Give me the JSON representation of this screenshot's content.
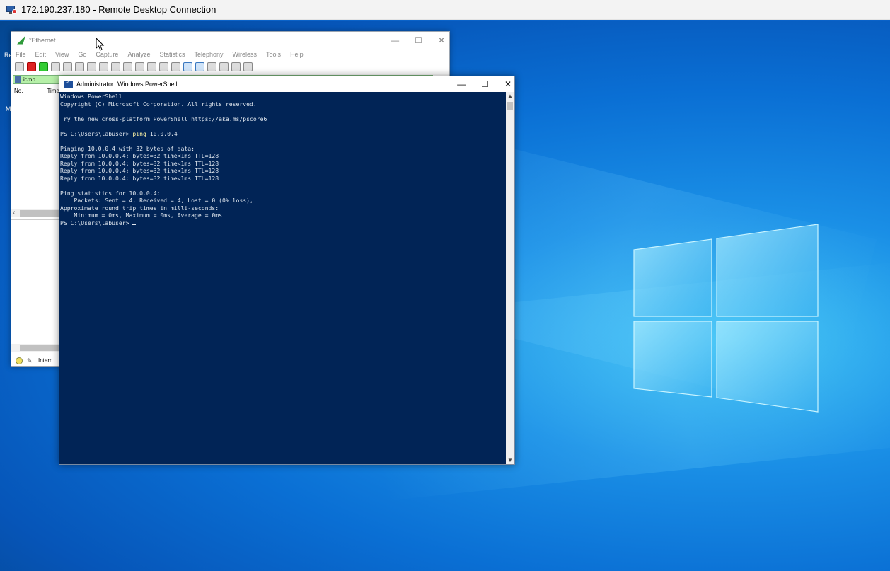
{
  "rdp": {
    "title": "172.190.237.180 - Remote Desktop Connection"
  },
  "desktop": {
    "icon_labels": [
      "Re",
      "M"
    ]
  },
  "wireshark": {
    "title": "*Ethernet",
    "window_controls": [
      "—",
      "☐",
      "✕"
    ],
    "menu": [
      "File",
      "Edit",
      "View",
      "Go",
      "Capture",
      "Analyze",
      "Statistics",
      "Telephony",
      "Wireless",
      "Tools",
      "Help"
    ],
    "filter_value": "icmp",
    "columns": [
      "No.",
      "Time"
    ],
    "status_text": "Intern"
  },
  "powershell": {
    "title": "Administrator: Windows PowerShell",
    "window_controls": [
      "—",
      "☐",
      "✕"
    ],
    "lines": {
      "l1": "Windows PowerShell",
      "l2": "Copyright (C) Microsoft Corporation. All rights reserved.",
      "l3": "",
      "l4": "Try the new cross-platform PowerShell https://aka.ms/pscore6",
      "l5": "",
      "prompt1": "PS C:\\Users\\labuser> ",
      "cmd": "ping",
      "cmd_arg": " 10.0.0.4",
      "l7": "",
      "l8": "Pinging 10.0.0.4 with 32 bytes of data:",
      "l9": "Reply from 10.0.0.4: bytes=32 time<1ms TTL=128",
      "l10": "Reply from 10.0.0.4: bytes=32 time<1ms TTL=128",
      "l11": "Reply from 10.0.0.4: bytes=32 time<1ms TTL=128",
      "l12": "Reply from 10.0.0.4: bytes=32 time<1ms TTL=128",
      "l13": "",
      "l14": "Ping statistics for 10.0.0.4:",
      "l15": "    Packets: Sent = 4, Received = 4, Lost = 0 (0% loss),",
      "l16": "Approximate round trip times in milli-seconds:",
      "l17": "    Minimum = 0ms, Maximum = 0ms, Average = 0ms",
      "prompt2": "PS C:\\Users\\labuser> "
    },
    "colors": {
      "background": "#012456",
      "text": "#dfe6ee",
      "command": "#f9f1a5"
    }
  }
}
